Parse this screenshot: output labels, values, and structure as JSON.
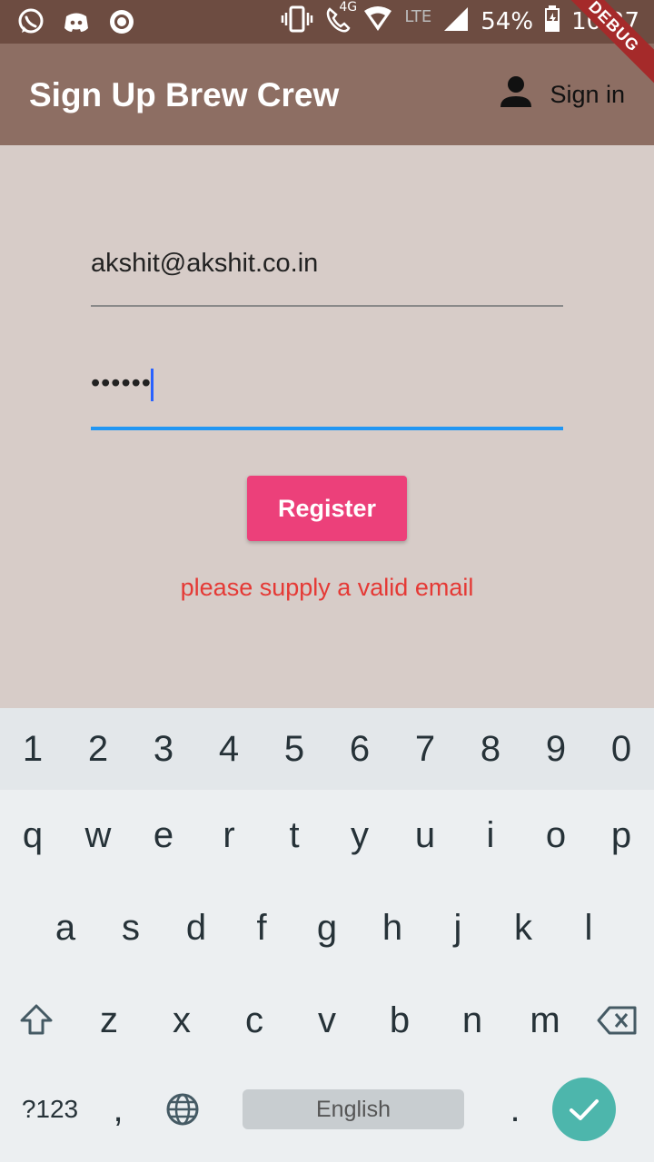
{
  "status_bar": {
    "network": "4G",
    "lte": "LTE",
    "battery": "54%",
    "time": "10:27",
    "icons": [
      "whatsapp-icon",
      "discord-icon",
      "record-icon",
      "vibrate-icon",
      "call-icon",
      "signal-icon",
      "battery-icon"
    ]
  },
  "debug_banner": "DEBUG",
  "app_bar": {
    "title": "Sign Up Brew Crew",
    "action_label": "Sign in",
    "action_icon": "person-icon"
  },
  "form": {
    "email_value": "akshit@akshit.co.in",
    "password_value": "••••••",
    "register_label": "Register",
    "error_message": "please supply a valid email"
  },
  "colors": {
    "status_bar": "#6d4c41",
    "app_bar": "#8d6e63",
    "background": "#d7ccc8",
    "register_button": "#ec407a",
    "error_text": "#e53935",
    "focus_underline": "#2196f3",
    "enter_key": "#4db6ac"
  },
  "keyboard": {
    "number_row": [
      "1",
      "2",
      "3",
      "4",
      "5",
      "6",
      "7",
      "8",
      "9",
      "0"
    ],
    "row1": [
      "q",
      "w",
      "e",
      "r",
      "t",
      "y",
      "u",
      "i",
      "o",
      "p"
    ],
    "row2": [
      "a",
      "s",
      "d",
      "f",
      "g",
      "h",
      "j",
      "k",
      "l"
    ],
    "row3": [
      "z",
      "x",
      "c",
      "v",
      "b",
      "n",
      "m"
    ],
    "symbols_label": "?123",
    "comma": ",",
    "space_label": "English",
    "period": "."
  }
}
